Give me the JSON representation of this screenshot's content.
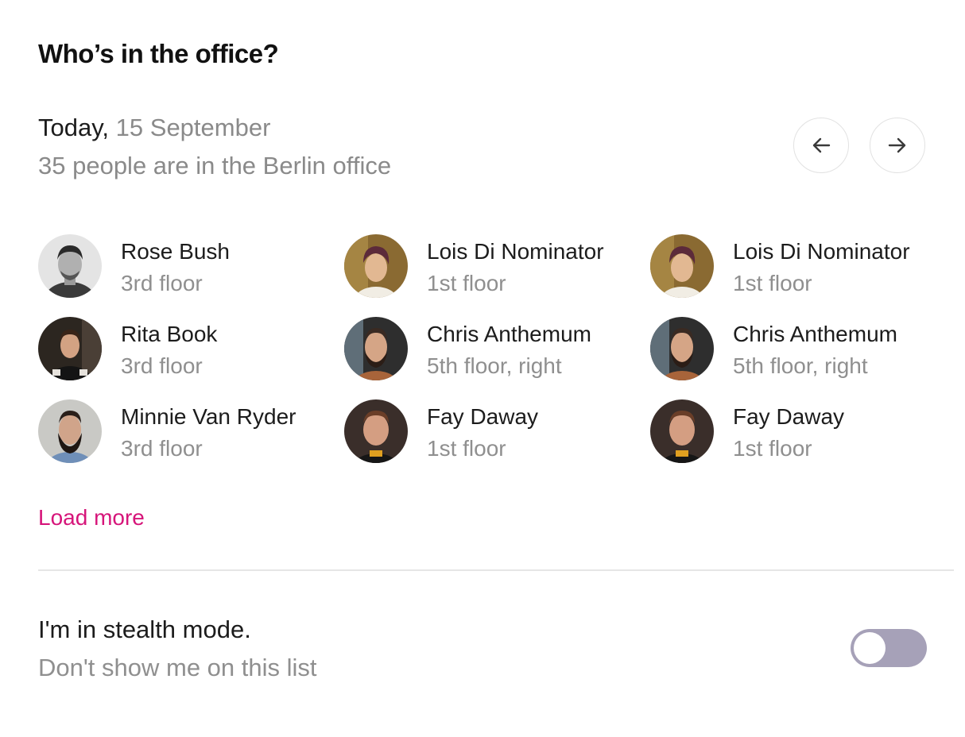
{
  "header": {
    "title": "Who’s in the office?"
  },
  "date_info": {
    "prefix": "Today,",
    "date": "15 September",
    "count_text": "35 people are in the Berlin office"
  },
  "nav": {
    "prev_icon": "arrow-left-icon",
    "next_icon": "arrow-right-icon"
  },
  "people": [
    {
      "name": "Rose Bush",
      "floor": "3rd floor"
    },
    {
      "name": "Lois Di Nominator",
      "floor": "1st floor"
    },
    {
      "name": "Lois Di Nominator",
      "floor": "1st floor"
    },
    {
      "name": "Rita Book",
      "floor": "3rd floor"
    },
    {
      "name": "Chris Anthemum",
      "floor": "5th floor, right"
    },
    {
      "name": "Chris Anthemum",
      "floor": "5th floor, right"
    },
    {
      "name": "Minnie Van Ryder",
      "floor": "3rd floor"
    },
    {
      "name": "Fay Daway",
      "floor": "1st floor"
    },
    {
      "name": "Fay Daway",
      "floor": "1st floor"
    }
  ],
  "load_more": {
    "label": "Load more"
  },
  "stealth": {
    "title": "I'm in stealth mode.",
    "subtitle": "Don't show me on this list",
    "enabled": false
  },
  "colors": {
    "accent": "#d6157a",
    "toggle_off": "#a6a1b8",
    "muted_text": "#8f8f8f"
  }
}
